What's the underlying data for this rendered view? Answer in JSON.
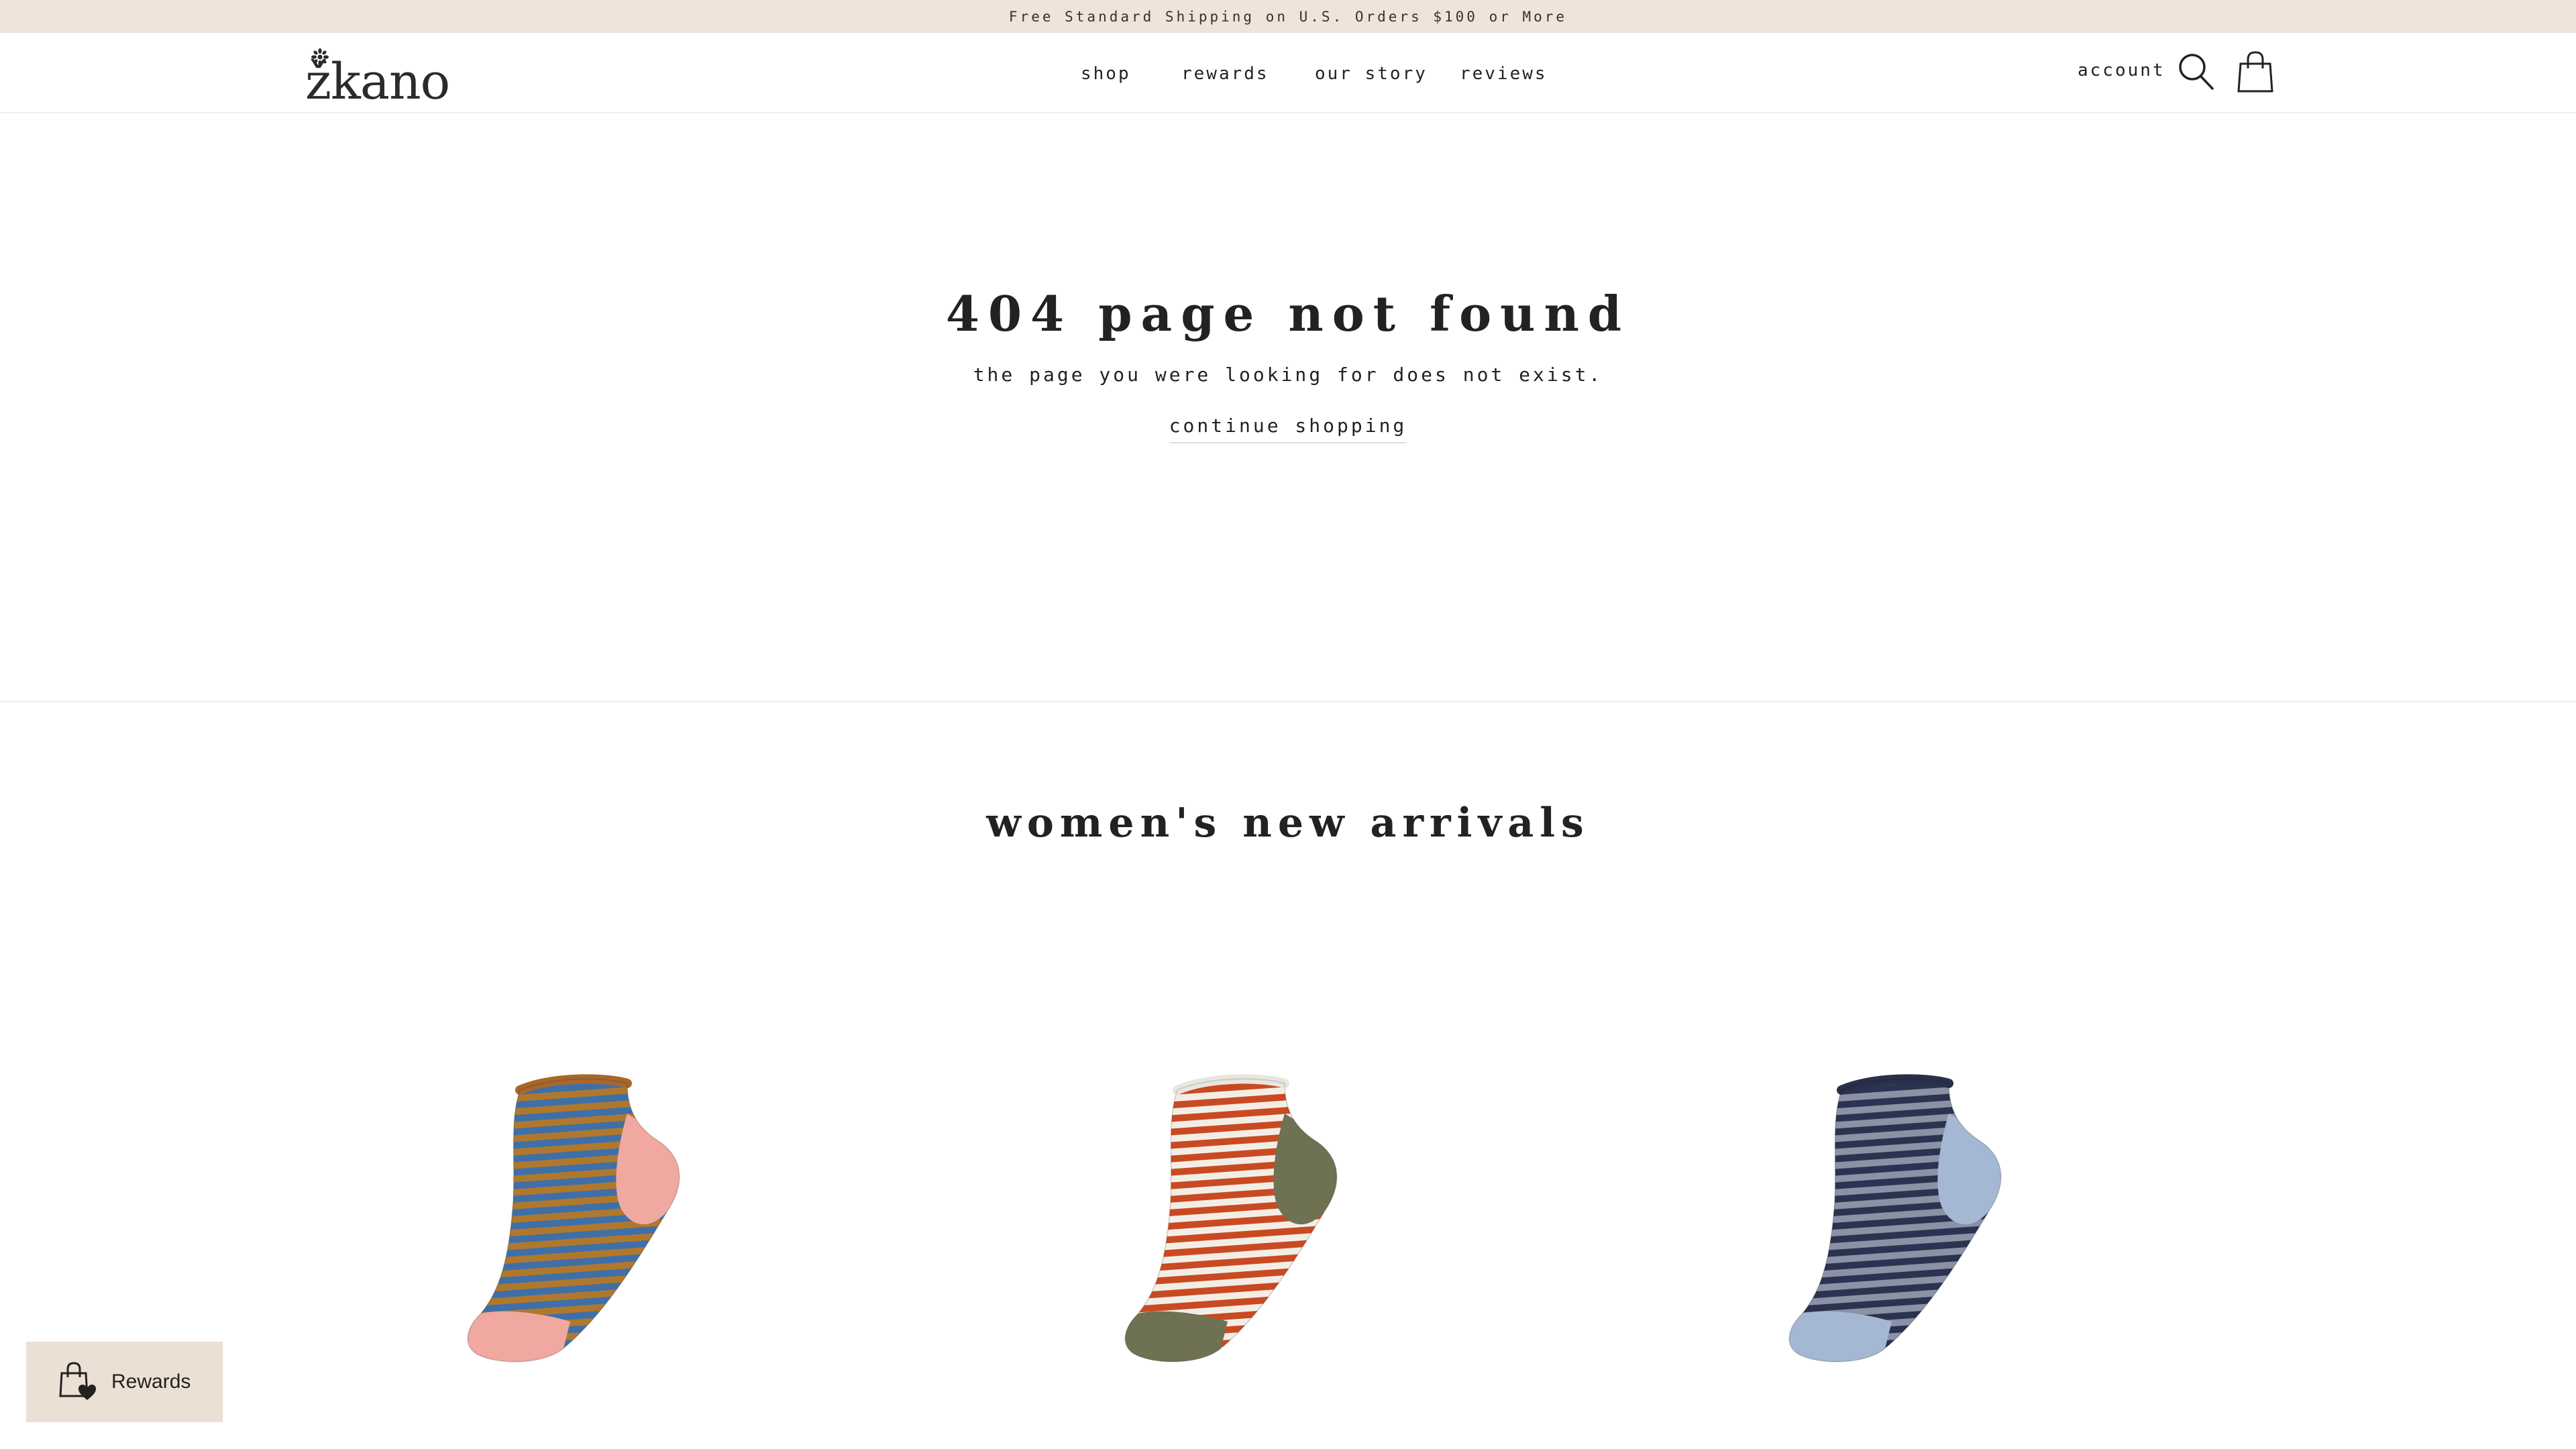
{
  "announcement": {
    "text": "Free Standard Shipping on U.S. Orders $100 or More"
  },
  "header": {
    "logo_text": "žkano",
    "nav": [
      {
        "label": "shop"
      },
      {
        "label": "rewards"
      },
      {
        "label": "our story"
      },
      {
        "label": "reviews"
      }
    ],
    "account_label": "account",
    "icons": {
      "search": "search-icon",
      "cart": "shopping-bag-icon"
    }
  },
  "main": {
    "title": "404 page not found",
    "subtitle": "the page you were looking for does not exist.",
    "continue_label": "continue shopping"
  },
  "arrivals": {
    "title": "women's new arrivals",
    "products": [
      {
        "name": "",
        "stripe_a": "#3f6fa8",
        "stripe_b": "#b0782d",
        "accent": "#f1a8a0",
        "cuff": "#a8672b"
      },
      {
        "name": "",
        "stripe_a": "#c94a22",
        "stripe_b": "#f3eee5",
        "accent": "#6e7152",
        "cuff": "#e9e6df"
      },
      {
        "name": "",
        "stripe_a": "#2c3350",
        "stripe_b": "#8b92a6",
        "accent": "#a5b8d3",
        "cuff": "#2a304a"
      }
    ]
  },
  "rewards_widget": {
    "label": "Rewards",
    "icon": "shopping-bag-heart-icon"
  },
  "colors": {
    "announcement_bg": "#f0e3d9",
    "rewards_bg": "#ecdfd4",
    "text": "#222222"
  }
}
